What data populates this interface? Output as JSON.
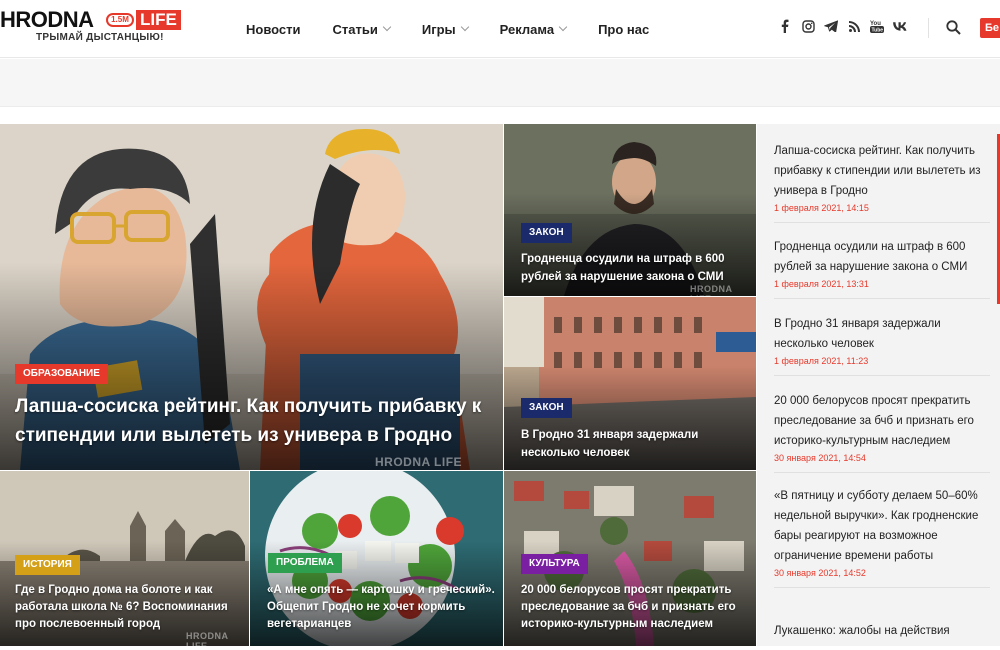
{
  "logo": {
    "name": "HRODNA",
    "badge": "1.5M",
    "life": "LIFE",
    "tagline": "ТРЫМАЙ ДЫСТАНЦЫЮ!"
  },
  "nav": [
    {
      "label": "Новости",
      "has_dropdown": false
    },
    {
      "label": "Статьи",
      "has_dropdown": true
    },
    {
      "label": "Игры",
      "has_dropdown": true
    },
    {
      "label": "Реклама",
      "has_dropdown": true
    },
    {
      "label": "Про нас",
      "has_dropdown": false
    }
  ],
  "social_icons": [
    "facebook-icon",
    "instagram-icon",
    "telegram-icon",
    "rss-icon",
    "youtube-icon",
    "vk-icon"
  ],
  "header_button": "Бе",
  "watermark": "HRODNA LIFE",
  "colors": {
    "accent": "#e7392b",
    "tag_law": "#1b2a6b",
    "tag_education": "#e7392b",
    "tag_history": "#d4a017",
    "tag_problem": "#2e9e4f",
    "tag_culture": "#7b1fa2"
  },
  "featured": {
    "tag": "ОБРАЗОВАНИЕ",
    "title": "Лапша-сосиска рейтинг. Как получить прибавку к стипендии или вылететь из универа в Гродно"
  },
  "tiles": [
    {
      "tag": "ЗАКОН",
      "title": "Гродненца осудили на штраф в 600 рублей за нарушение закона о СМИ"
    },
    {
      "tag": "ЗАКОН",
      "title": "В Гродно 31 января задержали несколько человек"
    },
    {
      "tag": "ИСТОРИЯ",
      "title": "Где в Гродно дома на болоте и как работала школа № 6? Воспоминания про послевоенный город"
    },
    {
      "tag": "ПРОБЛЕМА",
      "title": "«А мне опять — картошку и гречеcкий». Общепит Гродно не хочет кормить вегетарианцев"
    },
    {
      "tag": "КУЛЬТУРА",
      "title": "20 000 белорусов просят прекратить преследование за бчб и признать его историко-культурным наследием"
    }
  ],
  "sidebar": [
    {
      "title": "Лапша-сосиска рейтинг. Как получить прибавку к стипендии или вылететь из универа в Гродно",
      "date": "1 февраля 2021, 14:15"
    },
    {
      "title": "Гродненца осудили на штраф в 600 рублей за нарушение закона о СМИ",
      "date": "1 февраля 2021, 13:31"
    },
    {
      "title": "В Гродно 31 января задержали несколько человек",
      "date": "1 февраля 2021, 11:23"
    },
    {
      "title": "20 000 белорусов просят прекратить преследование за бчб и признать его историко-культурным наследием",
      "date": "30 января 2021, 14:54"
    },
    {
      "title": "«В пятницу и субботу делаем 50–60% недельной выручки». Как гродненские бары реагируют на возможное ограничение времени работы",
      "date": "30 января 2021, 14:52"
    },
    {
      "title": "Лукашенко: жалобы на действия",
      "date": ""
    }
  ]
}
